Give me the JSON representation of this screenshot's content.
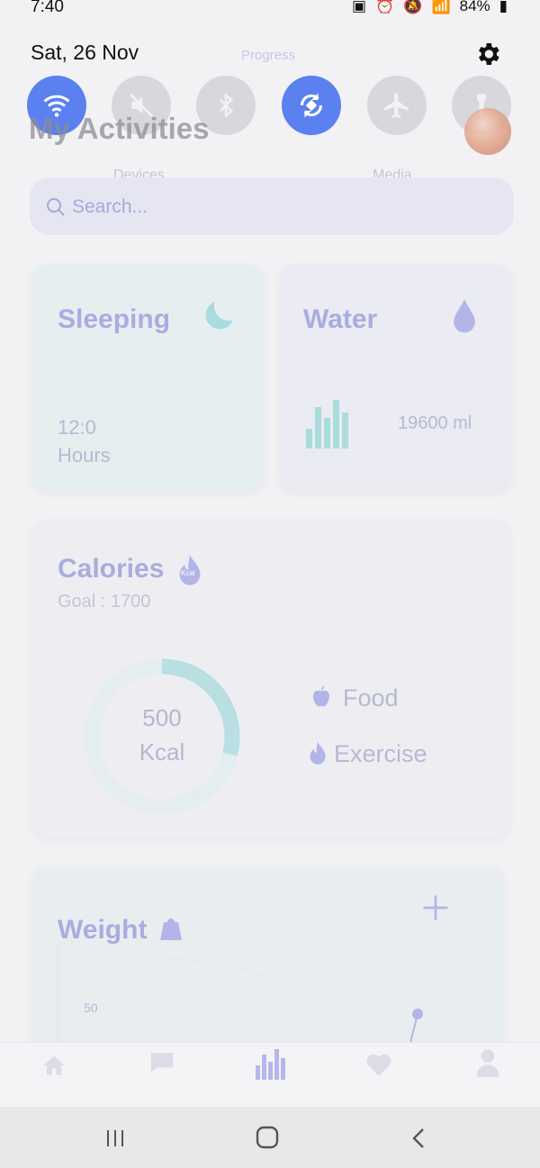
{
  "status_bar": {
    "time": "7:40",
    "battery": "84%"
  },
  "quick_settings": {
    "date": "Sat, 26 Nov",
    "tiles": [
      {
        "name": "wifi",
        "on": true
      },
      {
        "name": "sound-off",
        "on": false
      },
      {
        "name": "bluetooth",
        "on": false
      },
      {
        "name": "auto-rotate",
        "on": true
      },
      {
        "name": "airplane-mode",
        "on": false
      },
      {
        "name": "flashlight",
        "on": false
      }
    ],
    "devices_label": "Devices",
    "media_label": "Media"
  },
  "header": {
    "title": "My Activities"
  },
  "search": {
    "placeholder": "Search..."
  },
  "sleeping": {
    "title": "Sleeping",
    "value": "12:0",
    "unit": "Hours"
  },
  "water": {
    "title": "Water",
    "value": "19600 ml"
  },
  "calories": {
    "title": "Calories",
    "badge": "Kcal",
    "goal": "Goal : 1700",
    "value": "500",
    "unit": "Kcal",
    "progress": 0.29,
    "legend": {
      "food": "Food",
      "exercise": "Exercise"
    }
  },
  "weight": {
    "title": "Weight",
    "tick_label": "50"
  },
  "nav": {
    "active_label": "Progress"
  },
  "colors": {
    "accent": "#5b80f0",
    "lavender": "#a9acdf",
    "teal": "#a9dcdc"
  }
}
